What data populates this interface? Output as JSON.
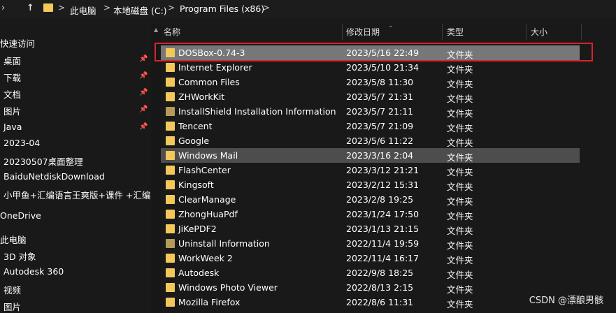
{
  "address": {
    "back": "›",
    "up": "↑",
    "crumbs": [
      "此电脑",
      "本地磁盘 (C:)",
      "Program Files (x86)"
    ],
    "separator": ">"
  },
  "sidebar": {
    "quick_access": "快速访问",
    "items": [
      {
        "label": "桌面",
        "pinned": true
      },
      {
        "label": "下载",
        "pinned": true
      },
      {
        "label": "文档",
        "pinned": true
      },
      {
        "label": "图片",
        "pinned": true
      },
      {
        "label": "Java",
        "pinned": true
      },
      {
        "label": "2023-04",
        "pinned": false
      },
      {
        "label": "20230507桌面整理",
        "pinned": false
      },
      {
        "label": "BaiduNetdiskDownload",
        "pinned": false
      },
      {
        "label": "小甲鱼+汇编语言王爽版+课件 +汇编+",
        "pinned": false
      }
    ],
    "onedrive": "OneDrive",
    "this_pc": "此电脑",
    "pc_items": [
      "3D 对象",
      "Autodesk 360",
      "视频",
      "图片"
    ]
  },
  "columns": {
    "name": "名称",
    "modified": "修改日期",
    "type": "类型",
    "size": "大小"
  },
  "files": [
    {
      "name": "DOSBox-0.74-3",
      "date": "2023/5/16 22:49",
      "type": "文件夹",
      "state": "selected"
    },
    {
      "name": "Internet Explorer",
      "date": "2023/5/10 21:34",
      "type": "文件夹"
    },
    {
      "name": "Common Files",
      "date": "2023/5/8 11:30",
      "type": "文件夹"
    },
    {
      "name": "ZHWorkKit",
      "date": "2023/5/7 21:31",
      "type": "文件夹"
    },
    {
      "name": "InstallShield Installation Information",
      "date": "2023/5/7 21:11",
      "type": "文件夹",
      "icon": "locked"
    },
    {
      "name": "Tencent",
      "date": "2023/5/7 21:09",
      "type": "文件夹"
    },
    {
      "name": "Google",
      "date": "2023/5/6 11:22",
      "type": "文件夹"
    },
    {
      "name": "Windows Mail",
      "date": "2023/3/16 2:04",
      "type": "文件夹",
      "state": "hover"
    },
    {
      "name": "FlashCenter",
      "date": "2023/3/12 21:21",
      "type": "文件夹"
    },
    {
      "name": "Kingsoft",
      "date": "2023/2/12 15:31",
      "type": "文件夹"
    },
    {
      "name": "ClearManage",
      "date": "2023/2/8 19:25",
      "type": "文件夹"
    },
    {
      "name": "ZhongHuaPdf",
      "date": "2023/1/24 17:50",
      "type": "文件夹"
    },
    {
      "name": "JiKePDF2",
      "date": "2023/1/13 21:15",
      "type": "文件夹"
    },
    {
      "name": "Uninstall Information",
      "date": "2022/11/4 19:59",
      "type": "文件夹",
      "icon": "locked"
    },
    {
      "name": "WorkWeek 2",
      "date": "2022/11/4 16:17",
      "type": "文件夹"
    },
    {
      "name": "Autodesk",
      "date": "2022/9/8 18:25",
      "type": "文件夹"
    },
    {
      "name": "Windows Photo Viewer",
      "date": "2022/8/13 2:15",
      "type": "文件夹"
    },
    {
      "name": "Mozilla Firefox",
      "date": "2022/8/6 11:31",
      "type": "文件夹"
    }
  ],
  "watermark": "CSDN @漂酿男骸",
  "colors": {
    "folder": "#f3c85a",
    "selection": "#777777",
    "highlight_box": "#d9232c"
  }
}
